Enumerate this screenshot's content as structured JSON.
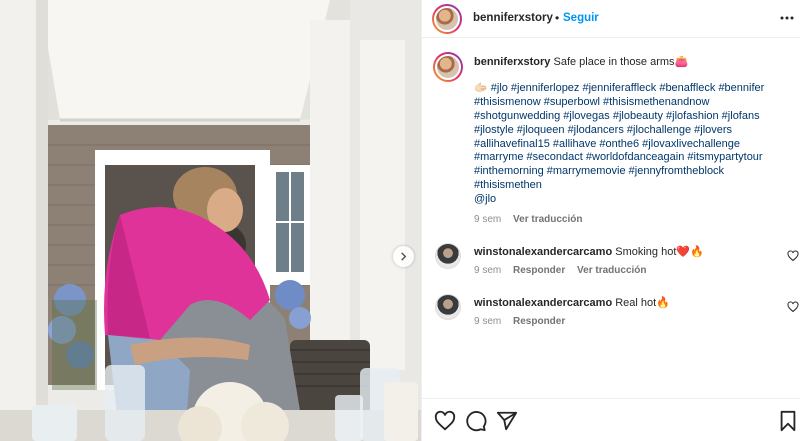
{
  "header": {
    "username": "benniferxstory",
    "separator": "•",
    "follow_label": "Seguir"
  },
  "caption": {
    "username": "benniferxstory",
    "text": "Safe place in those arms👛",
    "hashtags": "🫱🏻 #jlo #jenniferlopez #jenniferaffleck #benaffleck #bennifer\n#thisismenow #superbowl #thisismethenandnow\n#shotgunwedding #jlovegas #jlobeauty #jlofashion #jlofans\n#jlostyle #jloqueen #jlodancers #jlochallenge #jlovers\n#allihavefinal15 #allihave #onthe6 #jlovaxlivechallenge\n#marryme #secondact #worldofdanceagain #itsmypartytour\n#inthemorning #marrymemovie #jennyfromtheblock\n#thisismethen\n@jlo",
    "time": "9 sem",
    "translate_label": "Ver traducción"
  },
  "comments": [
    {
      "username": "winstonalexandercarcamo",
      "text": "Smoking hot❤️🔥",
      "time": "9 sem",
      "reply_label": "Responder",
      "translate_label": "Ver traducción"
    },
    {
      "username": "winstonalexandercarcamo",
      "text": "Real hot🔥",
      "time": "9 sem",
      "reply_label": "Responder"
    }
  ],
  "icons": {
    "more": "more-options-icon",
    "like": "heart-icon",
    "comment": "comment-icon",
    "share": "share-icon",
    "save": "bookmark-icon",
    "next": "chevron-right-icon"
  },
  "colors": {
    "accent": "#0095f6",
    "hashtag": "#00376b",
    "muted": "#8e8e8e"
  }
}
